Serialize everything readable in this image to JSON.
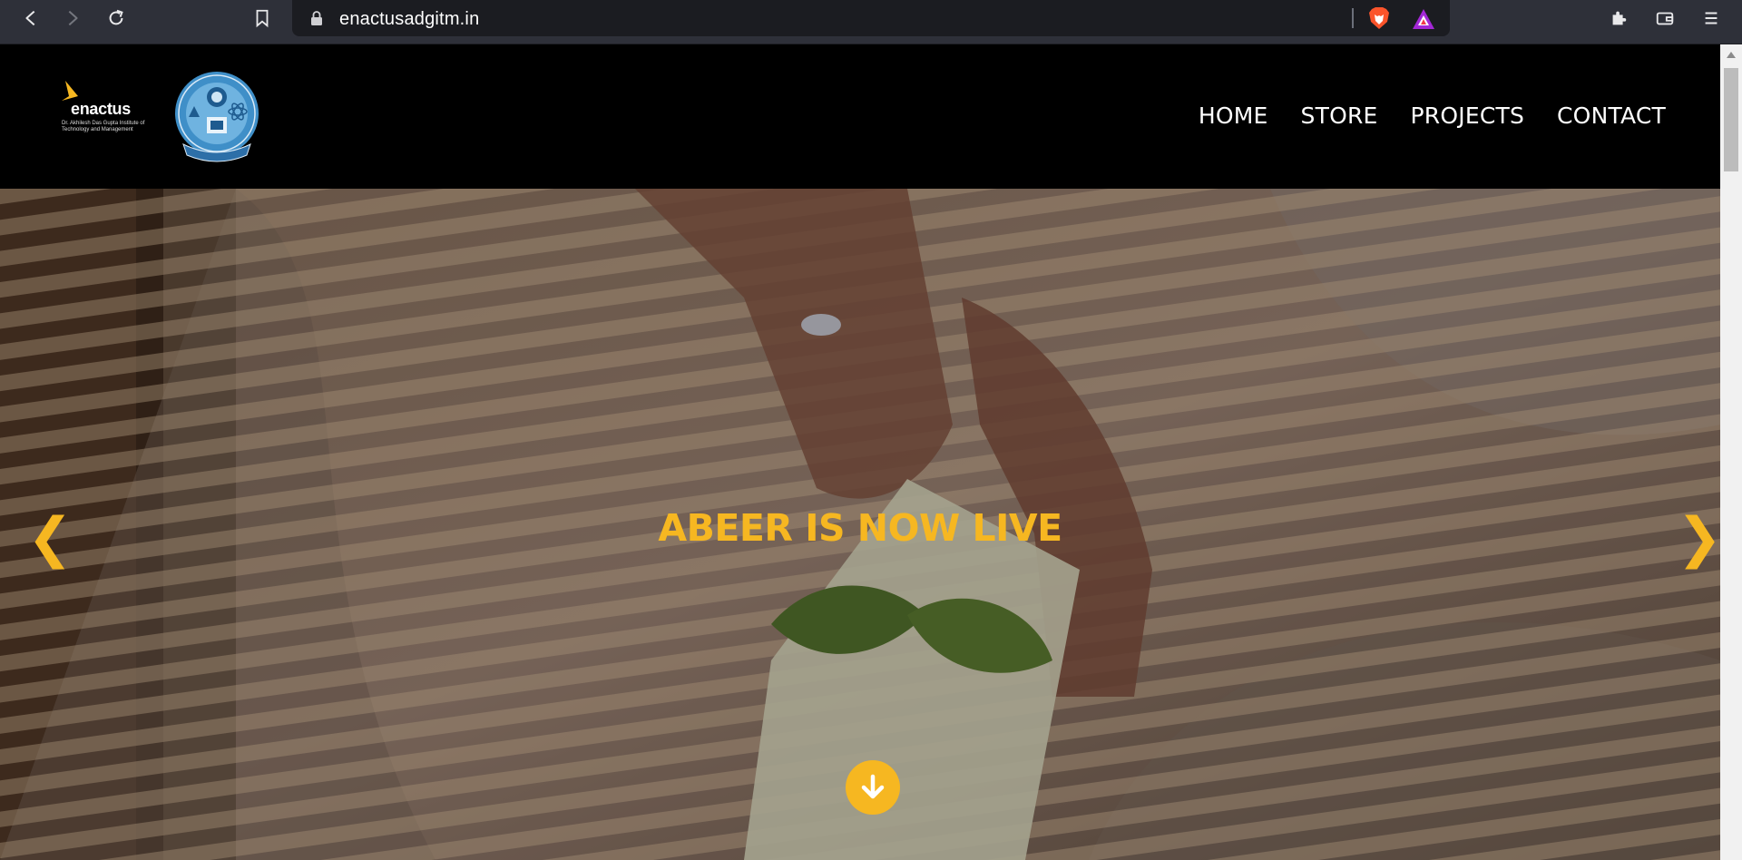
{
  "browser": {
    "url": "enactusadgitm.in",
    "icons": {
      "back": "back-icon",
      "forward": "forward-icon",
      "reload": "reload-icon",
      "bookmark": "bookmark-icon",
      "lock": "lock-icon",
      "shields": "brave-shields-icon",
      "rewards": "brave-rewards-icon",
      "extensions": "extensions-icon",
      "wallet": "wallet-icon",
      "menu": "menu-icon"
    }
  },
  "header": {
    "logo_brand": "enactus",
    "logo_subtitle": "Dr. Akhilesh Das Gupta Institute of Technology and Management",
    "nav": [
      {
        "label": "HOME"
      },
      {
        "label": "STORE"
      },
      {
        "label": "PROJECTS"
      },
      {
        "label": "CONTACT"
      }
    ]
  },
  "hero": {
    "title": "ABEER IS NOW LIVE",
    "prev_arrow": "❮",
    "next_arrow": "❯"
  },
  "colors": {
    "accent": "#f6b721",
    "header_bg": "#000000",
    "browser_bg": "#2e3039",
    "url_bg": "#1b1c21"
  }
}
